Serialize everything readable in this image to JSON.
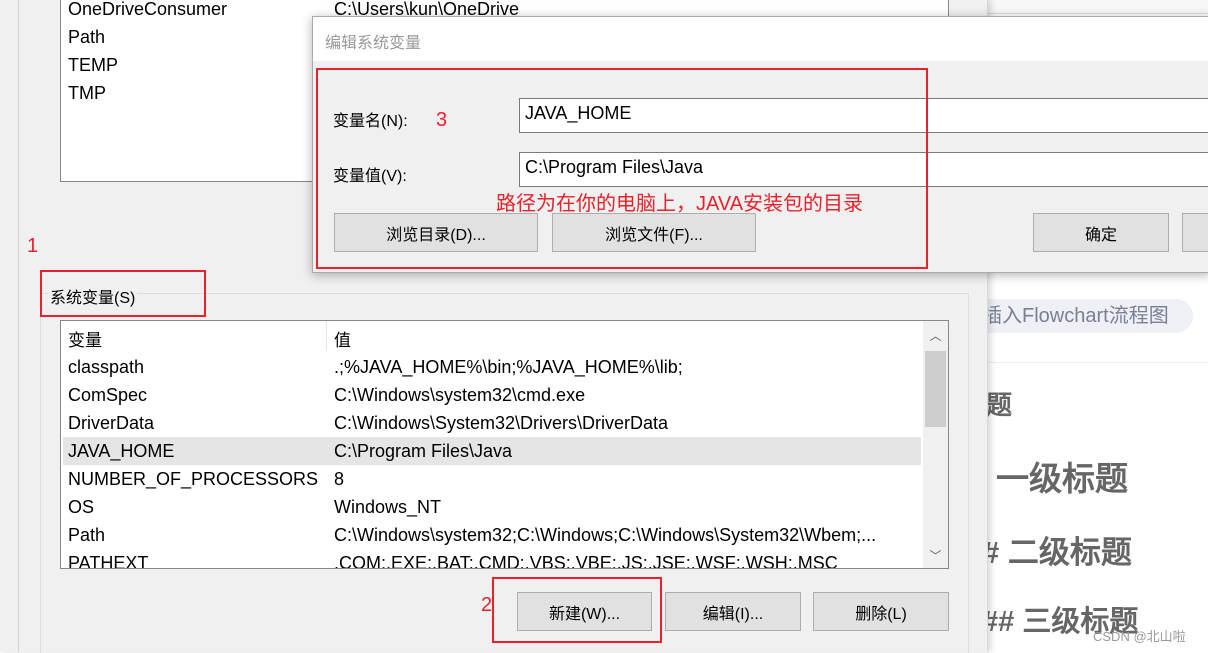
{
  "background_editor": {
    "pill": "插入Flowchart流程图",
    "headings": [
      "题",
      "一级标题",
      "# 二级标题",
      "## 三级标题"
    ],
    "watermark": "CSDN @北山啦"
  },
  "user_vars": {
    "rows": [
      {
        "name": "OneDriveConsumer",
        "value": "C:\\Users\\kun\\OneDrive"
      },
      {
        "name": "Path",
        "value": ""
      },
      {
        "name": "TEMP",
        "value": ""
      },
      {
        "name": "TMP",
        "value": ""
      }
    ]
  },
  "system_vars": {
    "label": "系统变量(S)",
    "headers": {
      "name": "变量",
      "value": "值"
    },
    "rows": [
      {
        "name": "classpath",
        "value": ".;%JAVA_HOME%\\bin;%JAVA_HOME%\\lib;"
      },
      {
        "name": "ComSpec",
        "value": "C:\\Windows\\system32\\cmd.exe"
      },
      {
        "name": "DriverData",
        "value": "C:\\Windows\\System32\\Drivers\\DriverData"
      },
      {
        "name": "JAVA_HOME",
        "value": "C:\\Program Files\\Java",
        "selected": true
      },
      {
        "name": "NUMBER_OF_PROCESSORS",
        "value": "8"
      },
      {
        "name": "OS",
        "value": "Windows_NT"
      },
      {
        "name": "Path",
        "value": "C:\\Windows\\system32;C:\\Windows;C:\\Windows\\System32\\Wbem;..."
      },
      {
        "name": "PATHEXT",
        "value": ".COM;.EXE;.BAT;.CMD;.VBS;.VBE;.JS;.JSE;.WSF;.WSH;.MSC"
      }
    ],
    "buttons": {
      "new": "新建(W)...",
      "edit": "编辑(I)...",
      "delete": "删除(L)"
    }
  },
  "dialog": {
    "title": "编辑系统变量",
    "name_label": "变量名(N):",
    "name_value": "JAVA_HOME",
    "value_label": "变量值(V):",
    "value_value": "C:\\Program Files\\Java",
    "browse_dir": "浏览目录(D)...",
    "browse_file": "浏览文件(F)...",
    "ok": "确定"
  },
  "annotations": {
    "step1": "1",
    "step2": "2",
    "step3": "3",
    "note": "路径为在你的电脑上，JAVA安装包的目录",
    "color": "#e8212b"
  }
}
